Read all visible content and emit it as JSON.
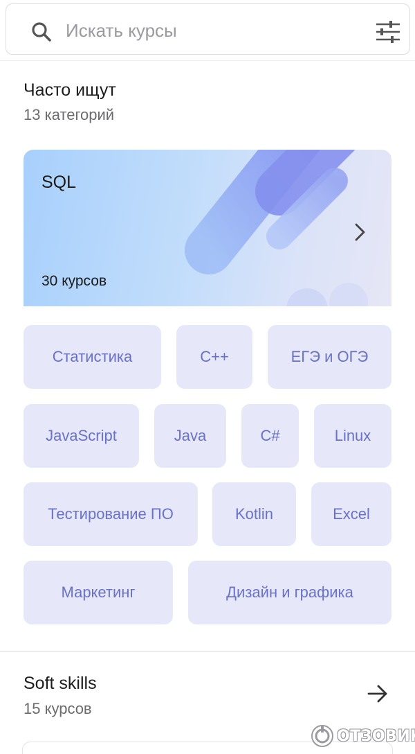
{
  "search": {
    "placeholder": "Искать курсы",
    "icon": "search-icon",
    "filter_icon": "sliders-icon"
  },
  "popular": {
    "title": "Часто ищут",
    "subtitle": "13 категорий",
    "featured": {
      "title": "SQL",
      "count": "30 курсов",
      "icon": "chevron-right-icon"
    },
    "chips": [
      "Статистика",
      "C++",
      "ЕГЭ и ОГЭ",
      "JavaScript",
      "Java",
      "C#",
      "Linux",
      "Тестирование ПО",
      "Kotlin",
      "Excel",
      "Маркетинг",
      "Дизайн и графика"
    ]
  },
  "soft_skills": {
    "title": "Soft skills",
    "subtitle": "15 курсов",
    "icon": "arrow-right-icon"
  },
  "watermark": {
    "text": "ОТЗОВИК"
  },
  "colors": {
    "chip_bg": "#e6e7f8",
    "chip_text": "#6a72c8",
    "accent_shape": "#7f8ef0"
  }
}
